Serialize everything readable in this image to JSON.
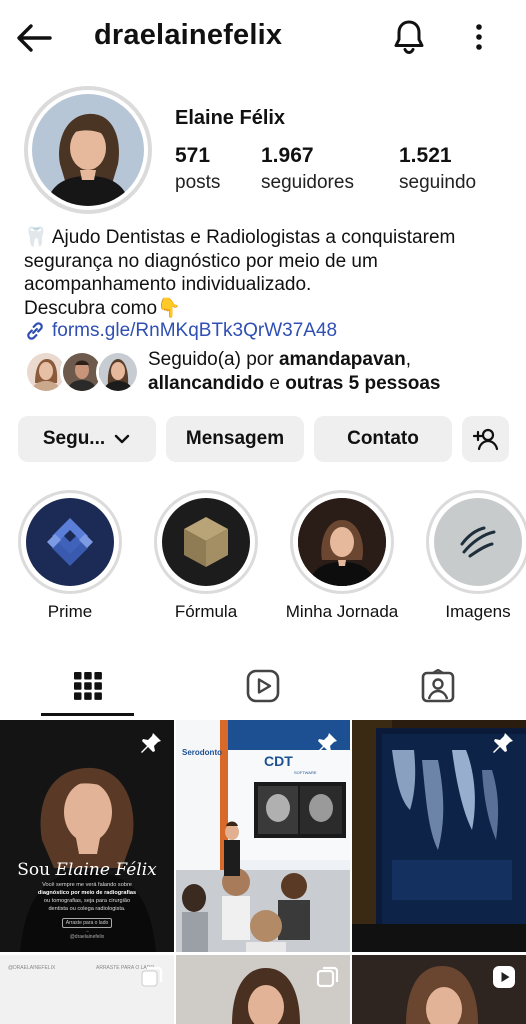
{
  "header": {
    "username": "draelainefelix",
    "back_icon": "arrow-left-icon",
    "bell_icon": "bell-icon",
    "more_icon": "more-vertical-icon"
  },
  "profile": {
    "full_name": "Elaine Félix",
    "stats": [
      {
        "value": "571",
        "label": "posts"
      },
      {
        "value": "1.967",
        "label": "seguidores"
      },
      {
        "value": "1.521",
        "label": "seguindo"
      }
    ],
    "bio_lines": [
      "🦷 Ajudo Dentistas e Radiologistas a conquistarem",
      "segurança no diagnóstico por meio de um",
      "acompanhamento individualizado.",
      "Descubra como👇"
    ],
    "link": "forms.gle/RnMKqBTk3QrW37A48",
    "followed_by": {
      "prefix": "Seguido(a) por ",
      "user1": "amandapavan",
      "comma": ",",
      "user2": "allancandido",
      "middle": " e ",
      "others": "outras 5 pessoas"
    }
  },
  "actions": {
    "following": "Segu...",
    "message": "Mensagem",
    "contact": "Contato",
    "add_user_icon": "add-user-icon"
  },
  "highlights": [
    {
      "label": "Prime"
    },
    {
      "label": "Fórmula"
    },
    {
      "label": "Minha Jornada"
    },
    {
      "label": "Imagens"
    }
  ],
  "tabs": [
    "grid-icon",
    "reels-icon",
    "tagged-icon"
  ],
  "posts": {
    "post1": {
      "title_sou": "Sou",
      "title_name": "Elaine Félix",
      "body_1": "Você sempre me verá falando sobre",
      "body_2": "diagnóstico por meio de radiografias",
      "body_3": "ou tomografias, seja para cirurgião",
      "body_4": "dentista ou colega radiologista.",
      "cta": "Arraste para o lado →",
      "handle": "@draelainefelix"
    },
    "post2": {
      "banner": "CDT",
      "banner_sub": "SOFTWARE",
      "side_sign": "Serodonto"
    },
    "post4_label": "@DRAELAINEFELIX",
    "post4_label2": "ARRASTE PARA O LADO"
  },
  "colors": {
    "link": "#2f4fb3",
    "button_bg": "#efefef",
    "ring": "#dbdbdb"
  }
}
